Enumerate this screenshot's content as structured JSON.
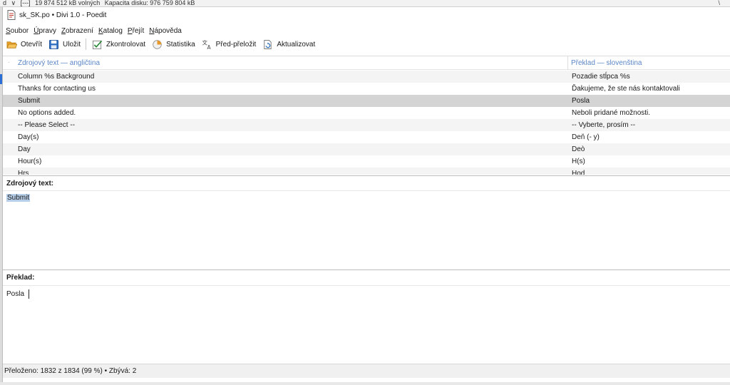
{
  "background": {
    "strip_items": [
      "d",
      "∨",
      "[---]",
      "19 874 512 kB volných",
      "Kapacita disku: 976 759 804 kB"
    ],
    "right_mark": "\\"
  },
  "window": {
    "title": "sk_SK.po • Divi 1.0 - Poedit",
    "icon": "poedit-document-icon"
  },
  "menubar": {
    "items": [
      {
        "underline": "S",
        "rest": "oubor"
      },
      {
        "underline": "Ú",
        "rest": "pravy"
      },
      {
        "underline": "Z",
        "rest": "obrazení"
      },
      {
        "underline": "K",
        "rest": "atalog"
      },
      {
        "underline": "P",
        "rest": "řejít"
      },
      {
        "underline": "N",
        "rest": "ápověda"
      }
    ]
  },
  "toolbar": {
    "open_label": "Otevřít",
    "save_label": "Uložit",
    "validate_label": "Zkontrolovat",
    "stats_label": "Statistika",
    "pretranslate_label": "Před-přeložit",
    "update_label": "Aktualizovat",
    "icon_names": [
      "folder-open-icon",
      "floppy-disk-icon",
      "checkmark-icon",
      "pie-chart-icon",
      "translate-icon",
      "refresh-document-icon"
    ]
  },
  "list": {
    "header_marker": "·",
    "source_header": "Zdrojový text — angličtina",
    "translation_header": "Překlad — slovenština",
    "rows": [
      {
        "source": "Column %s Background",
        "translation": "Pozadie stĺpca %s"
      },
      {
        "source": "Thanks for contacting us",
        "translation": "Ďakujeme, že ste nás kontaktovali"
      },
      {
        "source": "Submit",
        "translation": "Posla"
      },
      {
        "source": "No options added.",
        "translation": "Neboli pridané možnosti."
      },
      {
        "source": "-- Please Select --",
        "translation": "-- Vyberte, prosím --"
      },
      {
        "source": "Day(s)",
        "translation": "Deň (- y)"
      },
      {
        "source": "Day",
        "translation": "Deò"
      },
      {
        "source": "Hour(s)",
        "translation": "H(s)"
      },
      {
        "source": "Hrs",
        "translation": "Hod"
      }
    ],
    "selected_index": 2
  },
  "source_pane": {
    "label": "Zdrojový text:",
    "text": "Submit"
  },
  "translation_pane": {
    "label": "Překlad:",
    "text": "Posla"
  },
  "status": {
    "text": "Přeloženo: 1832 z 1834 (99 %)  •  Zbývá: 2"
  },
  "colors": {
    "header_text": "#5b86c7",
    "selected_row": "#d4d4d4",
    "source_highlight": "#b7cfe9"
  }
}
